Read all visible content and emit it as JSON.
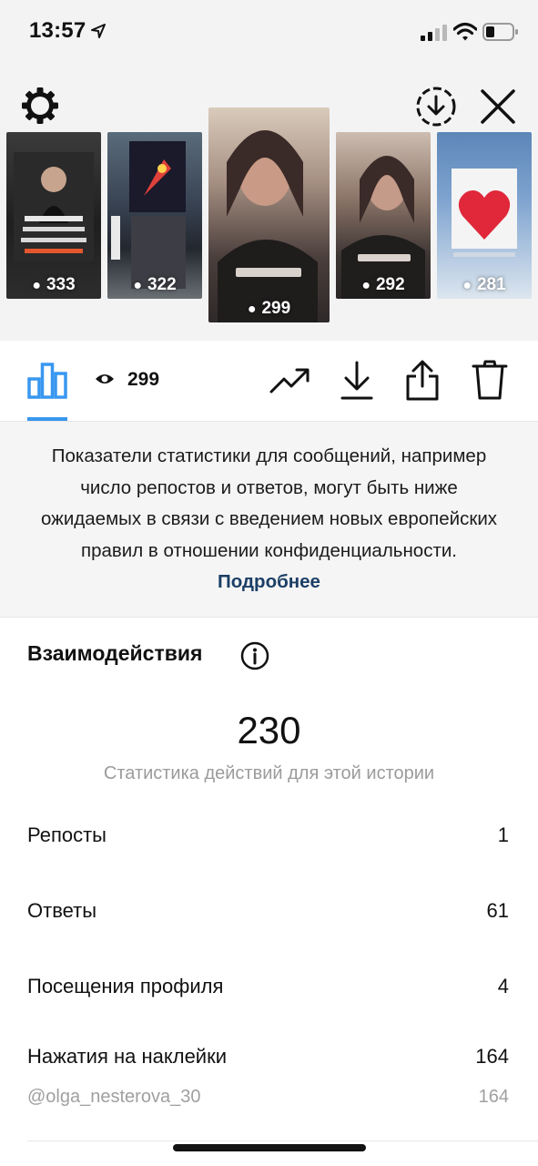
{
  "status_bar": {
    "time": "13:57"
  },
  "stories": [
    {
      "views": "333"
    },
    {
      "views": "322"
    },
    {
      "views": "299"
    },
    {
      "views": "292"
    },
    {
      "views": "281"
    }
  ],
  "toolbar": {
    "views": "299"
  },
  "notice": {
    "text": "Показатели статистики для сообщений, например число репостов и ответов, могут быть ниже ожидаемых в связи с введением новых европейских правил в отношении конфиденциальности.",
    "link": "Подробнее"
  },
  "interactions": {
    "title": "Взаимодействия",
    "total": "230",
    "caption": "Статистика действий для этой истории",
    "rows": [
      {
        "label": "Репосты",
        "value": "1"
      },
      {
        "label": "Ответы",
        "value": "61"
      },
      {
        "label": "Посещения профиля",
        "value": "4"
      },
      {
        "label": "Нажатия на наклейки",
        "value": "164"
      }
    ],
    "sub": {
      "label": "@olga_nesterova_30",
      "value": "164"
    }
  },
  "colors": {
    "accent": "#3897f0",
    "link": "#1b3f66",
    "muted": "#9b9b9b"
  }
}
